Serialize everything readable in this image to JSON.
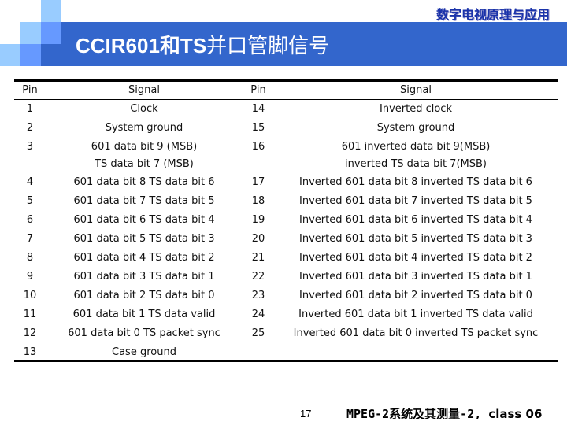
{
  "header": {
    "course_title": "数字电视原理与应用",
    "slide_title_latin": "CCIR601和TS",
    "slide_title_cn": "并口管脚信号"
  },
  "colors": {
    "banner": "#3366cc",
    "square_light": "#99ccff",
    "square_mid": "#6699ff",
    "course_title": "#1a33aa"
  },
  "table": {
    "headers": [
      "Pin",
      "Signal",
      "Pin",
      "Signal"
    ],
    "rows": [
      {
        "pin1": "1",
        "signal1": [
          "Clock"
        ],
        "pin2": "14",
        "signal2": [
          "Inverted clock"
        ]
      },
      {
        "pin1": "2",
        "signal1": [
          "System ground"
        ],
        "pin2": "15",
        "signal2": [
          "System ground"
        ]
      },
      {
        "pin1": "3",
        "signal1": [
          "601 data bit 9 (MSB)",
          "TS data bit 7 (MSB)"
        ],
        "pin2": "16",
        "signal2": [
          "601 inverted data bit 9(MSB)",
          "inverted TS data bit 7(MSB)"
        ]
      },
      {
        "pin1": "4",
        "signal1": [
          "601 data bit 8 TS data bit 6"
        ],
        "pin2": "17",
        "signal2": [
          "Inverted 601 data bit 8 inverted TS data bit 6"
        ]
      },
      {
        "pin1": "5",
        "signal1": [
          "601 data bit 7 TS data bit 5"
        ],
        "pin2": "18",
        "signal2": [
          "Inverted 601 data bit 7 inverted TS data bit 5"
        ]
      },
      {
        "pin1": "6",
        "signal1": [
          "601 data bit 6 TS data bit 4"
        ],
        "pin2": "19",
        "signal2": [
          "Inverted 601 data bit 6 inverted TS data bit 4"
        ]
      },
      {
        "pin1": "7",
        "signal1": [
          "601 data bit 5 TS data bit 3"
        ],
        "pin2": "20",
        "signal2": [
          "Inverted 601 data bit 5 inverted TS data bit 3"
        ]
      },
      {
        "pin1": "8",
        "signal1": [
          "601 data bit 4 TS data bit 2"
        ],
        "pin2": "21",
        "signal2": [
          "Inverted 601 data bit 4 inverted TS data bit 2"
        ]
      },
      {
        "pin1": "9",
        "signal1": [
          "601 data bit 3 TS data bit 1"
        ],
        "pin2": "22",
        "signal2": [
          "Inverted 601 data bit 3 inverted TS data bit 1"
        ]
      },
      {
        "pin1": "10",
        "signal1": [
          "601 data bit 2 TS data bit 0"
        ],
        "pin2": "23",
        "signal2": [
          "Inverted 601 data bit 2 inverted TS data bit 0"
        ]
      },
      {
        "pin1": "11",
        "signal1": [
          "601 data bit 1 TS data valid"
        ],
        "pin2": "24",
        "signal2": [
          "Inverted 601 data bit 1 inverted TS data valid"
        ]
      },
      {
        "pin1": "12",
        "signal1": [
          "601 data bit 0 TS packet sync"
        ],
        "pin2": "25",
        "signal2": [
          "Inverted 601 data bit 0 inverted TS packet sync"
        ]
      },
      {
        "pin1": "13",
        "signal1": [
          "Case ground"
        ],
        "pin2": "",
        "signal2": [
          ""
        ]
      }
    ]
  },
  "footer": {
    "page_number": "17",
    "course_cn": "MPEG-2系统及其测量-2,",
    "course_en": "class 06"
  }
}
